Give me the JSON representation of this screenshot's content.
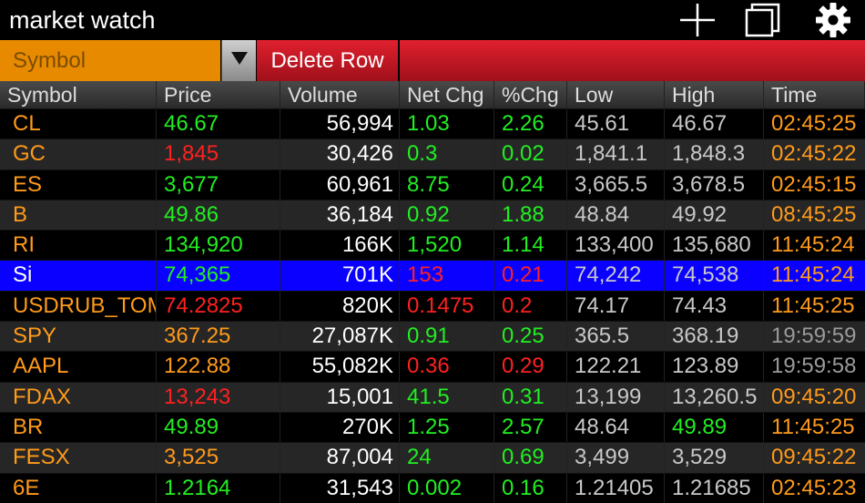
{
  "app": {
    "title": "market watch"
  },
  "toolbar": {
    "symbol_placeholder": "Symbol",
    "delete_label": "Delete Row",
    "icons": [
      "plus-icon",
      "copy-icon",
      "gear-icon",
      "dropdown-arrow-icon"
    ]
  },
  "colors": {
    "up": "#22ee22",
    "down": "#ff2020",
    "neutral_orange": "#ff9a1a",
    "white": "#ffffff",
    "grey": "#c8c8c8",
    "stale_time": "#9a9a9a",
    "selected_row": "#0a00ff",
    "symbol_field": "#e88a00",
    "delete_button": "#d0182a"
  },
  "table": {
    "columns": [
      "Symbol",
      "Price",
      "Volume",
      "Net Chg",
      "%Chg",
      "Low",
      "High",
      "Time"
    ],
    "rows": [
      {
        "symbol": "CL",
        "price": "46.67",
        "volume": "56,994",
        "net_chg": "1.03",
        "pct_chg": "2.26",
        "low": "45.61",
        "high": "46.67",
        "time": "02:45:25",
        "price_color": "up",
        "chg_color": "up",
        "high_color": "grey",
        "time_color": "neutral_orange",
        "selected": false
      },
      {
        "symbol": "GC",
        "price": "1,845",
        "volume": "30,426",
        "net_chg": "0.3",
        "pct_chg": "0.02",
        "low": "1,841.1",
        "high": "1,848.3",
        "time": "02:45:22",
        "price_color": "down",
        "chg_color": "up",
        "high_color": "grey",
        "time_color": "neutral_orange",
        "selected": false
      },
      {
        "symbol": "ES",
        "price": "3,677",
        "volume": "60,961",
        "net_chg": "8.75",
        "pct_chg": "0.24",
        "low": "3,665.5",
        "high": "3,678.5",
        "time": "02:45:15",
        "price_color": "up",
        "chg_color": "up",
        "high_color": "grey",
        "time_color": "neutral_orange",
        "selected": false
      },
      {
        "symbol": "B",
        "price": "49.86",
        "volume": "36,184",
        "net_chg": "0.92",
        "pct_chg": "1.88",
        "low": "48.84",
        "high": "49.92",
        "time": "08:45:25",
        "price_color": "up",
        "chg_color": "up",
        "high_color": "grey",
        "time_color": "neutral_orange",
        "selected": false
      },
      {
        "symbol": "RI",
        "price": "134,920",
        "volume": "166K",
        "net_chg": "1,520",
        "pct_chg": "1.14",
        "low": "133,400",
        "high": "135,680",
        "time": "11:45:24",
        "price_color": "up",
        "chg_color": "up",
        "high_color": "grey",
        "time_color": "neutral_orange",
        "selected": false
      },
      {
        "symbol": "Si",
        "price": "74,365",
        "volume": "701K",
        "net_chg": "153",
        "pct_chg": "0.21",
        "low": "74,242",
        "high": "74,538",
        "time": "11:45:24",
        "price_color": "up",
        "chg_color": "down",
        "high_color": "grey",
        "time_color": "neutral_orange",
        "selected": true
      },
      {
        "symbol": "USDRUB_TOM",
        "price": "74.2825",
        "volume": "820K",
        "net_chg": "0.1475",
        "pct_chg": "0.2",
        "low": "74.17",
        "high": "74.43",
        "time": "11:45:25",
        "price_color": "down",
        "chg_color": "down",
        "high_color": "grey",
        "time_color": "neutral_orange",
        "selected": false
      },
      {
        "symbol": "SPY",
        "price": "367.25",
        "volume": "27,087K",
        "net_chg": "0.91",
        "pct_chg": "0.25",
        "low": "365.5",
        "high": "368.19",
        "time": "19:59:59",
        "price_color": "neutral_orange",
        "chg_color": "up",
        "high_color": "grey",
        "time_color": "stale_time",
        "selected": false
      },
      {
        "symbol": "AAPL",
        "price": "122.88",
        "volume": "55,082K",
        "net_chg": "0.36",
        "pct_chg": "0.29",
        "low": "122.21",
        "high": "123.89",
        "time": "19:59:58",
        "price_color": "neutral_orange",
        "chg_color": "down",
        "high_color": "grey",
        "time_color": "stale_time",
        "selected": false
      },
      {
        "symbol": "FDAX",
        "price": "13,243",
        "volume": "15,001",
        "net_chg": "41.5",
        "pct_chg": "0.31",
        "low": "13,199",
        "high": "13,260.5",
        "time": "09:45:20",
        "price_color": "down",
        "chg_color": "up",
        "high_color": "grey",
        "time_color": "neutral_orange",
        "selected": false
      },
      {
        "symbol": "BR",
        "price": "49.89",
        "volume": "270K",
        "net_chg": "1.25",
        "pct_chg": "2.57",
        "low": "48.64",
        "high": "49.89",
        "time": "11:45:25",
        "price_color": "up",
        "chg_color": "up",
        "high_color": "up",
        "time_color": "neutral_orange",
        "selected": false
      },
      {
        "symbol": "FESX",
        "price": "3,525",
        "volume": "87,004",
        "net_chg": "24",
        "pct_chg": "0.69",
        "low": "3,499",
        "high": "3,529",
        "time": "09:45:22",
        "price_color": "neutral_orange",
        "chg_color": "up",
        "high_color": "grey",
        "time_color": "neutral_orange",
        "selected": false
      },
      {
        "symbol": "6E",
        "price": "1.2164",
        "volume": "31,543",
        "net_chg": "0.002",
        "pct_chg": "0.16",
        "low": "1.21405",
        "high": "1.21685",
        "time": "02:45:23",
        "price_color": "up",
        "chg_color": "up",
        "high_color": "grey",
        "time_color": "neutral_orange",
        "selected": false
      }
    ]
  }
}
